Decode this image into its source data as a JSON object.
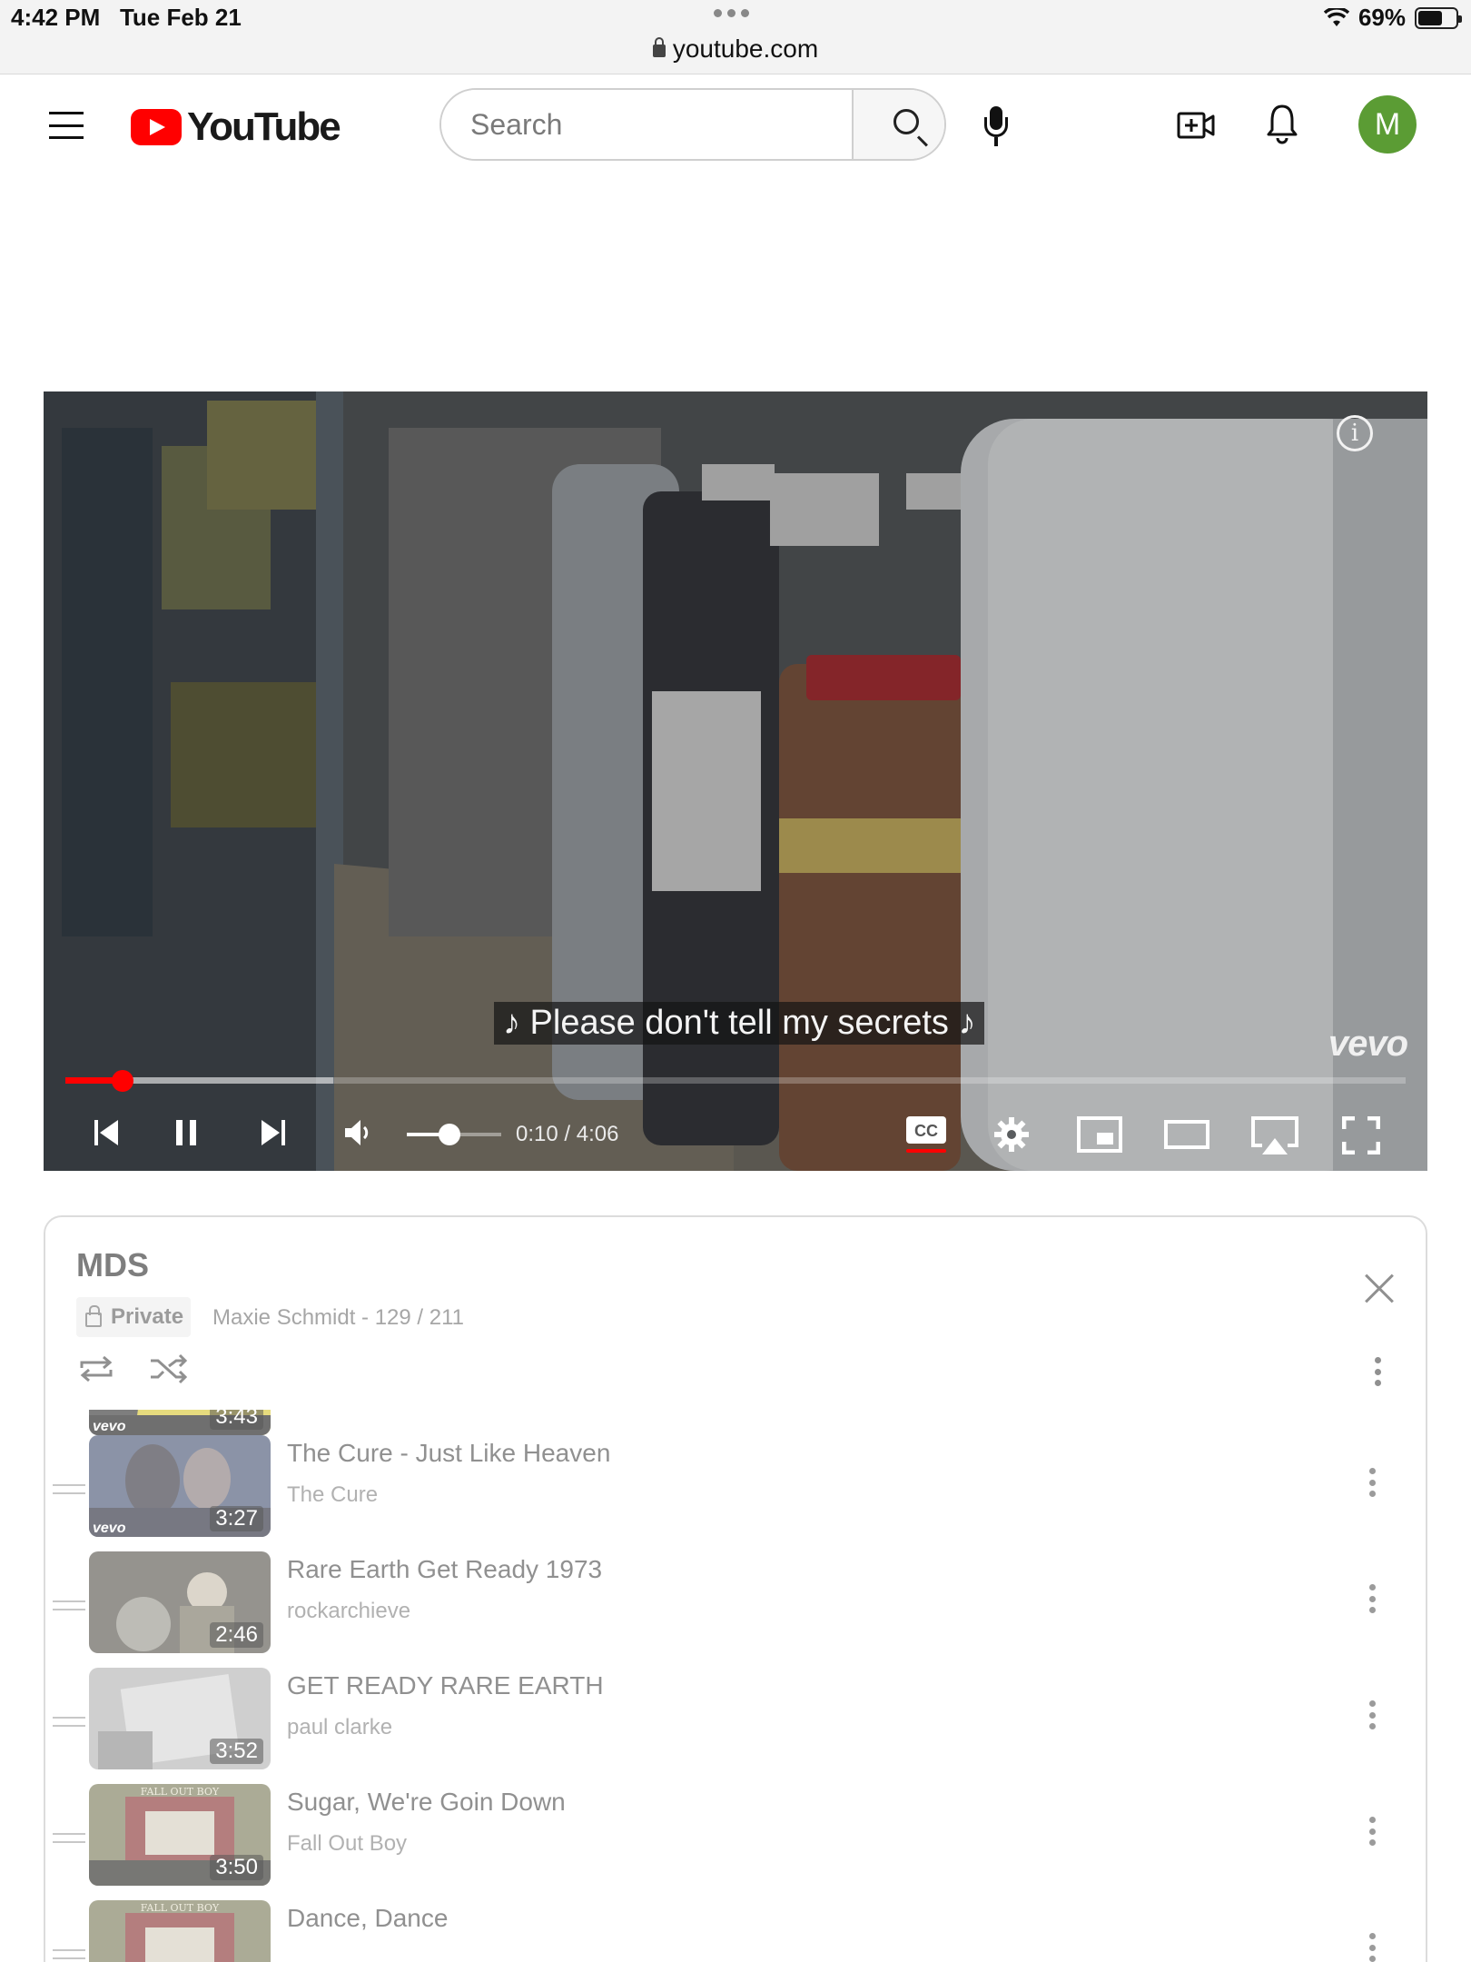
{
  "status_bar": {
    "time": "4:42 PM",
    "date": "Tue Feb 21",
    "battery": "69%",
    "battery_level": 0.69,
    "icons": [
      "wifi-icon",
      "battery-icon"
    ]
  },
  "browser": {
    "url": "youtube.com",
    "icons": [
      "lock-icon",
      "more-dots-icon"
    ]
  },
  "header": {
    "logo_text": "YouTube",
    "search_placeholder": "Search",
    "search_value": "",
    "avatar_letter": "M",
    "colors": {
      "logo_red": "#ff0000",
      "avatar_bg": "#5b9c34"
    },
    "icons": [
      "menu-icon",
      "search-icon",
      "mic-icon",
      "create-video-icon",
      "notifications-bell-icon"
    ]
  },
  "player": {
    "caption": "♪ Please don't tell my secrets ♪",
    "watermark": "vevo",
    "current_time": "0:10",
    "duration": "4:06",
    "time_display": "0:10 / 4:06",
    "progress_fraction": 0.043,
    "buffered_fraction": 0.2,
    "volume_fraction": 0.45,
    "captions_on": true,
    "colors": {
      "progress": "#ff0000"
    },
    "icons": [
      "info-icon",
      "previous-icon",
      "pause-icon",
      "next-icon",
      "volume-icon",
      "captions-icon",
      "settings-gear-icon",
      "miniplayer-icon",
      "theater-mode-icon",
      "airplay-icon",
      "fullscreen-icon"
    ]
  },
  "playlist": {
    "title": "MDS",
    "privacy": "Private",
    "owner_line": "Maxie Schmidt - 129 / 211",
    "icons": [
      "loop-icon",
      "shuffle-icon",
      "close-icon",
      "more-vertical-icon"
    ],
    "items": [
      {
        "title": "",
        "channel": "",
        "duration": "3:43",
        "badge": "vevo"
      },
      {
        "title": "The Cure - Just Like Heaven",
        "channel": "The Cure",
        "duration": "3:27",
        "badge": "vevo"
      },
      {
        "title": "Rare Earth Get Ready 1973",
        "channel": "rockarchieve",
        "duration": "2:46",
        "badge": ""
      },
      {
        "title": "GET READY RARE EARTH",
        "channel": "paul clarke",
        "duration": "3:52",
        "badge": ""
      },
      {
        "title": "Sugar, We're Goin Down",
        "channel": "Fall Out Boy",
        "duration": "3:50",
        "badge": "",
        "thumb_text": "FALL OUT BOY"
      },
      {
        "title": "Dance, Dance",
        "channel": "",
        "duration": "",
        "badge": "",
        "thumb_text": "FALL OUT BOY"
      }
    ]
  }
}
